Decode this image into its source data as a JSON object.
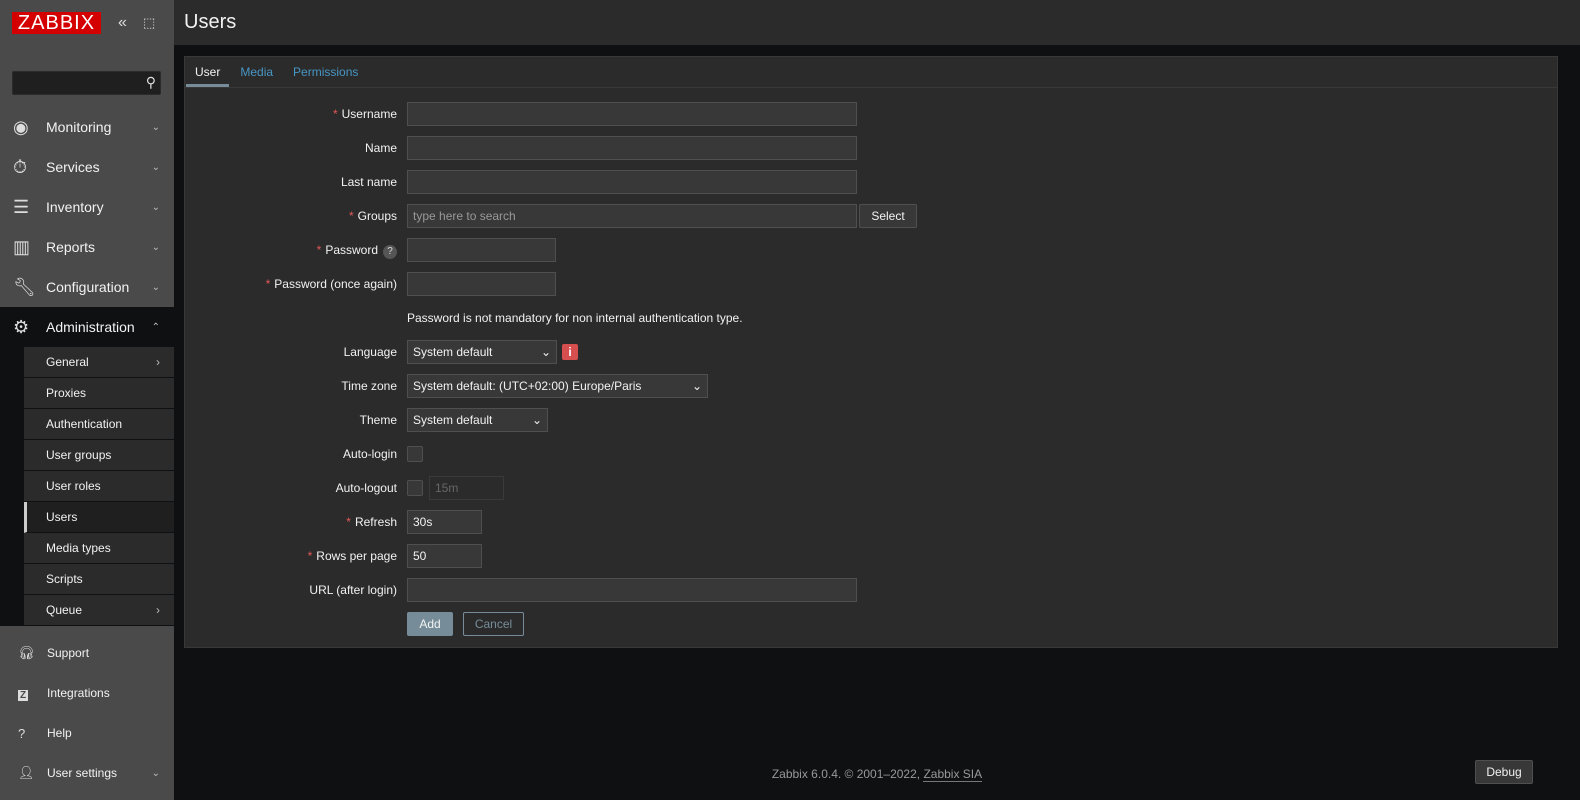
{
  "brand": {
    "logo": "ZABBIX",
    "collapse_icon": "chevrons-left",
    "kiosk_icon": "fullscreen"
  },
  "search": {
    "value": "",
    "placeholder": ""
  },
  "menu": [
    {
      "label": "Monitoring",
      "icon": "eye"
    },
    {
      "label": "Services",
      "icon": "stopwatch"
    },
    {
      "label": "Inventory",
      "icon": "list"
    },
    {
      "label": "Reports",
      "icon": "bar-chart"
    },
    {
      "label": "Configuration",
      "icon": "wrench"
    },
    {
      "label": "Administration",
      "icon": "gear"
    }
  ],
  "submenu": [
    "General",
    "Proxies",
    "Authentication",
    "User groups",
    "User roles",
    "Users",
    "Media types",
    "Scripts",
    "Queue"
  ],
  "bottom": [
    {
      "label": "Support",
      "icon": "headset"
    },
    {
      "label": "Integrations",
      "icon": "z"
    },
    {
      "label": "Help",
      "icon": "question"
    },
    {
      "label": "User settings",
      "icon": "user"
    }
  ],
  "page_title": "Users",
  "tabs": [
    "User",
    "Media",
    "Permissions"
  ],
  "form": {
    "username": {
      "label": "Username",
      "value": ""
    },
    "name": {
      "label": "Name",
      "value": ""
    },
    "last_name": {
      "label": "Last name",
      "value": ""
    },
    "groups": {
      "label": "Groups",
      "placeholder": "type here to search",
      "button": "Select"
    },
    "password": {
      "label": "Password",
      "help": "?",
      "value": ""
    },
    "password2": {
      "label": "Password (once again)",
      "value": ""
    },
    "password_note": "Password is not mandatory for non internal authentication type.",
    "language": {
      "label": "Language",
      "value": "System default",
      "info": "i"
    },
    "timezone": {
      "label": "Time zone",
      "value": "System default: (UTC+02:00) Europe/Paris"
    },
    "theme": {
      "label": "Theme",
      "value": "System default"
    },
    "autologin": {
      "label": "Auto-login",
      "checked": false
    },
    "autologout": {
      "label": "Auto-logout",
      "checked": false,
      "value": "15m"
    },
    "refresh": {
      "label": "Refresh",
      "value": "30s"
    },
    "rows": {
      "label": "Rows per page",
      "value": "50"
    },
    "url": {
      "label": "URL (after login)",
      "value": ""
    },
    "add": "Add",
    "cancel": "Cancel"
  },
  "footer": {
    "text": "Zabbix 6.0.4. © 2001–2022, ",
    "link": "Zabbix SIA",
    "debug": "Debug"
  },
  "colors": {
    "accent": "#d40000",
    "link": "#4796c4",
    "required": "#e45959"
  }
}
